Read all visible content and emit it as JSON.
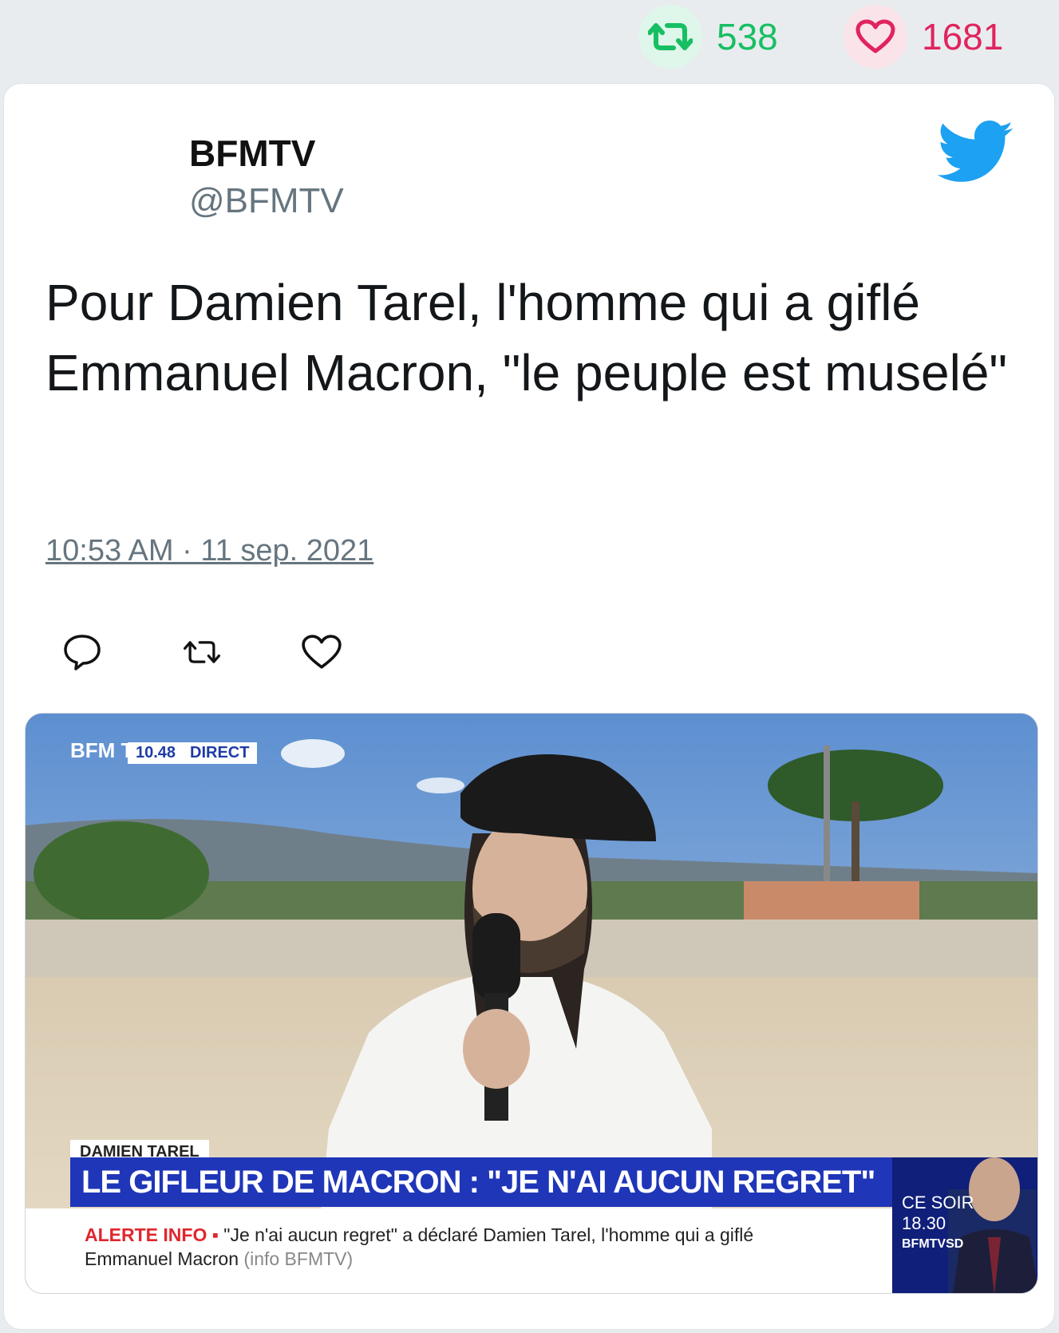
{
  "stats": {
    "retweets": "538",
    "likes": "1681",
    "retweet_color": "#17bf63",
    "like_color": "#e0245e",
    "retweet_icon": "retweet-icon",
    "like_icon": "heart-icon"
  },
  "tweet": {
    "name": "BFMTV",
    "handle": "@BFMTV",
    "text": "Pour Damien Tarel, l'homme qui a giflé Emmanuel Macron, \"le peuple est muselé\"",
    "timestamp": "10:53 AM · 11 sep. 2021",
    "logo_icon": "twitter-bird-icon",
    "brand_color": "#1da1f2"
  },
  "actions": [
    {
      "icon": "reply-icon"
    },
    {
      "icon": "retweet-icon"
    },
    {
      "icon": "heart-icon"
    }
  ],
  "media": {
    "channel_logo": "BFM TV.",
    "time": "10.48",
    "live": "DIRECT",
    "person_name": "DAMIEN TAREL",
    "headline": "LE GIFLEUR DE MACRON : \"JE N'AI AUCUN REGRET\"",
    "ticker_label": "ALERTE INFO",
    "ticker_text": "\"Je n'ai aucun regret\" a déclaré Damien Tarel, l'homme qui a giflé Emmanuel Macron",
    "ticker_source": "(info BFMTV)",
    "promo_line1": "CE SOIR",
    "promo_line2": "18.30",
    "promo_line3": "BFMTVSD"
  }
}
